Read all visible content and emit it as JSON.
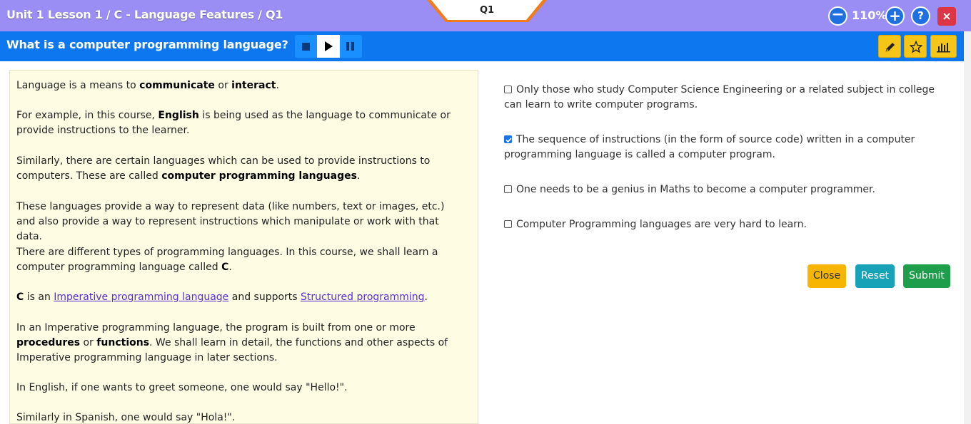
{
  "header": {
    "breadcrumb": "Unit 1 Lesson 1 / C - Language Features / Q1",
    "question_tab": "Q1",
    "zoom_minus": "−",
    "zoom_plus": "+",
    "zoom": "110%",
    "help": "?",
    "close": "×"
  },
  "question_bar": {
    "title": "What is a computer programming language?",
    "media_controls": [
      "stop-icon",
      "play-icon",
      "pause-icon"
    ],
    "tools": [
      "pencil-icon",
      "star-icon",
      "bar-chart-icon"
    ]
  },
  "reading": {
    "p1": {
      "t1": "Language is a means to ",
      "b1": "communicate",
      "t2": " or ",
      "b2": "interact",
      "t3": "."
    },
    "p2": {
      "t1": "For example, in this course, ",
      "b1": "English",
      "t2": " is being used as the language to communicate or provide instructions to the learner."
    },
    "p3": {
      "t1": "Similarly, there are certain languages which can be used to provide instructions to computers. These are called ",
      "b1": "computer programming languages",
      "t2": "."
    },
    "p4": "These languages provide a way to represent data (like numbers, text or images, etc.) and also provide a way to represent instructions which manipulate or work with that data.",
    "p5": {
      "t1": "There are different types of programming languages. In this course, we shall learn a computer programming language called ",
      "b1": "C",
      "t2": "."
    },
    "p6": {
      "b1": "C",
      "t1": " is an ",
      "l1": "Imperative programming language",
      "t2": " and supports ",
      "l2": "Structured programming",
      "t3": "."
    },
    "p7": {
      "t1": "In an Imperative programming language, the program is built from one or more ",
      "b1": "procedures",
      "t2": " or ",
      "b2": "functions",
      "t3": ". We shall learn in detail, the functions and other aspects of Imperative programming language in later sections."
    },
    "p8": "In English, if one wants to greet someone, one would say \"Hello!\".",
    "p9": "Similarly in Spanish, one would say \"Hola!\"."
  },
  "options": [
    {
      "label": "Only those who study Computer Science Engineering or a related subject in college can learn to write computer programs.",
      "checked": false
    },
    {
      "label": "The sequence of instructions (in the form of source code) written in a computer programming language is called a computer program.",
      "checked": true
    },
    {
      "label": "One needs to be a genius in Maths to become a computer programmer.",
      "checked": false
    },
    {
      "label": "Computer Programming languages are very hard to learn.",
      "checked": false
    }
  ],
  "actions": {
    "close": "Close",
    "reset": "Reset",
    "submit": "Submit"
  },
  "colors": {
    "header_bg": "#9a8df3",
    "question_bar_bg": "#0d77f0",
    "reading_bg": "#fefde3",
    "tab_accent": "#f07c1a"
  }
}
